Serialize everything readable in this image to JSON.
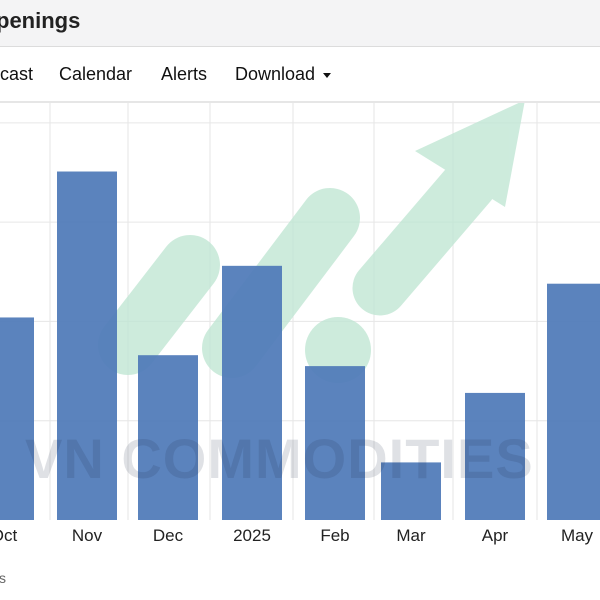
{
  "header": {
    "title": "penings"
  },
  "nav": {
    "items": [
      {
        "label": "cast"
      },
      {
        "label": "Calendar"
      },
      {
        "label": "Alerts"
      },
      {
        "label": "Download"
      }
    ]
  },
  "watermark": {
    "text": "VN COMMODITIES"
  },
  "footer": {
    "text": "cs"
  },
  "colors": {
    "bar": "#4f7ab8",
    "grid": "#e6e6e6",
    "watermark_green": "#bfe6d3"
  },
  "chart_data": {
    "type": "bar",
    "categories": [
      "Oct",
      "Nov",
      "Dec",
      "2025",
      "Feb",
      "Mar",
      "Apr",
      "May"
    ],
    "values": [
      204,
      351,
      166,
      256,
      155,
      58,
      128,
      238
    ],
    "ylim": [
      0,
      420
    ],
    "grid": true
  }
}
